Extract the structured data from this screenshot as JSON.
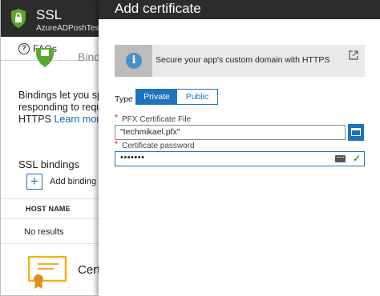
{
  "ssl_blade": {
    "title": "SSL",
    "subtitle": "AzureADPoshTest",
    "faqs_label": "FAQs",
    "section_heading_partial": "Bindi",
    "description_lines": [
      "Bindings let you spe",
      "responding to reque",
      "HTTPS"
    ],
    "learn_more": "Learn more",
    "ssl_bindings_heading": "SSL bindings",
    "add_binding_label": "Add binding",
    "host_name_header": "HOST NAME",
    "no_results": "No results",
    "certificates_heading_partial": "Certi"
  },
  "add_certificate": {
    "title": "Add certificate",
    "info_text": "Secure your app's custom domain with HTTPS",
    "type_label": "Type",
    "type_options": [
      "Private",
      "Public"
    ],
    "type_selected": "Private",
    "pfx_label": "PFX Certificate File",
    "pfx_value": "\"techmikael.pfx\"",
    "password_label": "Certificate password",
    "password_value": "•••••••",
    "required_marker": "*"
  },
  "colors": {
    "header_bg": "#2c2c2c",
    "accent": "#1e73be",
    "shield": "#5aa832",
    "required": "#e00000",
    "valid": "#3c9c3c"
  },
  "icons": {
    "app": "shield-lock-icon",
    "faq": "question-icon",
    "info": "info-icon",
    "external": "external-link-icon",
    "folder": "folder-icon",
    "keyboard": "keyboard-icon",
    "valid": "checkmark-icon",
    "add": "plus-icon",
    "certificate": "certificate-icon"
  }
}
